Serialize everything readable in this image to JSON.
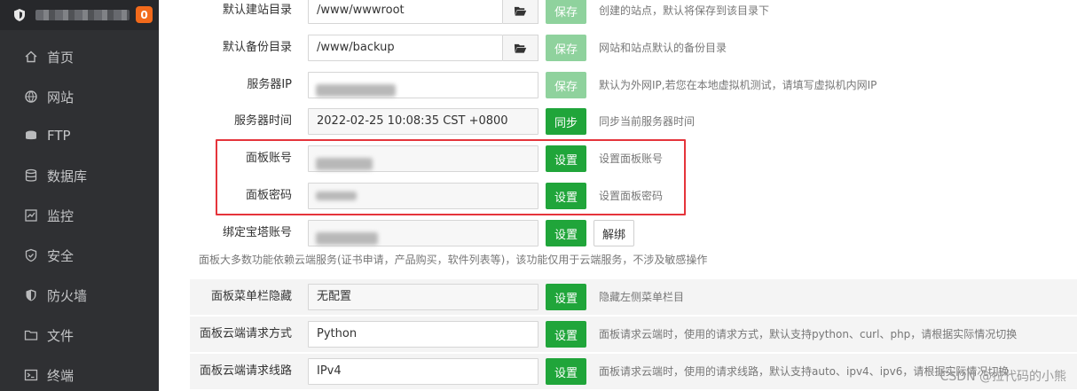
{
  "sidebar": {
    "badge": "0",
    "items": [
      {
        "label": "首页",
        "icon": "home-icon"
      },
      {
        "label": "网站",
        "icon": "globe-icon"
      },
      {
        "label": "FTP",
        "icon": "ftp-icon"
      },
      {
        "label": "数据库",
        "icon": "database-icon"
      },
      {
        "label": "监控",
        "icon": "monitor-icon"
      },
      {
        "label": "安全",
        "icon": "shield-check-icon"
      },
      {
        "label": "防火墙",
        "icon": "firewall-icon"
      },
      {
        "label": "文件",
        "icon": "folder-icon"
      },
      {
        "label": "终端",
        "icon": "terminal-icon"
      }
    ]
  },
  "form": {
    "site_dir": {
      "label": "默认建站目录",
      "value": "/www/wwwroot",
      "button": "保存",
      "hint": "创建的站点，默认将保存到该目录下"
    },
    "backup_dir": {
      "label": "默认备份目录",
      "value": "/www/backup",
      "button": "保存",
      "hint": "网站和站点默认的备份目录"
    },
    "server_ip": {
      "label": "服务器IP",
      "button": "保存",
      "hint": "默认为外网IP,若您在本地虚拟机测试，请填写虚拟机内网IP"
    },
    "server_time": {
      "label": "服务器时间",
      "value": "2022-02-25 10:08:35 CST +0800",
      "button": "同步",
      "hint": "同步当前服务器时间"
    },
    "panel_account": {
      "label": "面板账号",
      "button": "设置",
      "hint": "设置面板账号"
    },
    "panel_password": {
      "label": "面板密码",
      "button": "设置",
      "hint": "设置面板密码"
    },
    "bt_account": {
      "label": "绑定宝塔账号",
      "button": "设置",
      "unbind": "解绑"
    },
    "cloud_note": "面板大多数功能依赖云端服务(证书申请，产品购买，软件列表等)，该功能仅用于云端服务，不涉及敏感操作",
    "menu_hide": {
      "label": "面板菜单栏隐藏",
      "value": "无配置",
      "button": "设置",
      "hint": "隐藏左侧菜单栏目"
    },
    "request_method": {
      "label": "面板云端请求方式",
      "value": "Python",
      "button": "设置",
      "hint": "面板请求云端时，使用的请求方式，默认支持python、curl、php，请根据实际情况切换"
    },
    "request_line": {
      "label": "面板云端请求线路",
      "value": "IPv4",
      "button": "设置",
      "hint": "面板请求云端时，使用的请求线路，默认支持auto、ipv4、ipv6，请根据实际情况切换"
    }
  },
  "watermark": "CSDN @拉代码的小熊",
  "colors": {
    "sidebar_bg": "#2f3033",
    "green": "#20a53a",
    "pale_green": "#8fd29d",
    "badge": "#f26a1b",
    "highlight": "#e5343b"
  }
}
